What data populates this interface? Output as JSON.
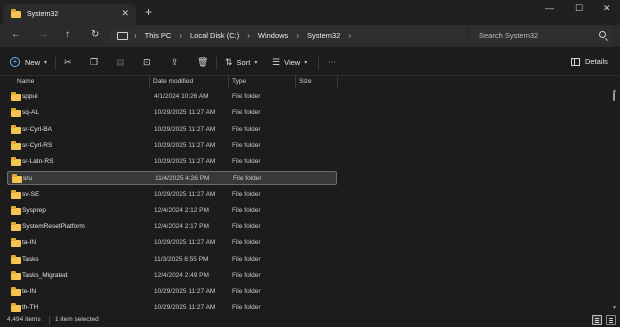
{
  "window": {
    "tab_title": "System32",
    "tab_close": "✕",
    "new_tab": "+",
    "minimize": "—",
    "maximize": "☐",
    "close": "✕"
  },
  "nav": {
    "back": "←",
    "forward": "→",
    "up": "↑",
    "refresh": "↻",
    "breadcrumbs": [
      "This PC",
      "Local Disk (C:)",
      "Windows",
      "System32"
    ],
    "separator": "›",
    "more": "›",
    "search_placeholder": "Search System32"
  },
  "toolbar": {
    "new_label": "New",
    "sort_label": "Sort",
    "view_label": "View",
    "more_label": "···",
    "details_label": "Details"
  },
  "columns": {
    "name": "Name",
    "date": "Date modified",
    "type": "Type",
    "size": "Size"
  },
  "rows": [
    {
      "name": "sppui",
      "date": "4/1/2024 10:26 AM",
      "type": "File folder"
    },
    {
      "name": "sq-AL",
      "date": "10/29/2025 11:27 AM",
      "type": "File folder"
    },
    {
      "name": "sr-Cyrl-BA",
      "date": "10/29/2025 11:27 AM",
      "type": "File folder"
    },
    {
      "name": "sr-Cyrl-RS",
      "date": "10/29/2025 11:27 AM",
      "type": "File folder"
    },
    {
      "name": "sr-Latn-RS",
      "date": "10/29/2025 11:27 AM",
      "type": "File folder"
    },
    {
      "name": "sru",
      "date": "11/4/2025 4:26 PM",
      "type": "File folder",
      "selected": true
    },
    {
      "name": "sv-SE",
      "date": "10/29/2025 11:27 AM",
      "type": "File folder"
    },
    {
      "name": "Sysprep",
      "date": "12/4/2024 2:12 PM",
      "type": "File folder"
    },
    {
      "name": "SystemResetPlatform",
      "date": "12/4/2024 2:17 PM",
      "type": "File folder"
    },
    {
      "name": "ta-IN",
      "date": "10/29/2025 11:27 AM",
      "type": "File folder"
    },
    {
      "name": "Tasks",
      "date": "11/3/2025 8:55 PM",
      "type": "File folder"
    },
    {
      "name": "Tasks_Migrated",
      "date": "12/4/2024 2:49 PM",
      "type": "File folder"
    },
    {
      "name": "te-IN",
      "date": "10/29/2025 11:27 AM",
      "type": "File folder"
    },
    {
      "name": "th-TH",
      "date": "10/29/2025 11:27 AM",
      "type": "File folder"
    }
  ],
  "status": {
    "item_count": "4,494 items",
    "selected": "1 item selected"
  },
  "colors": {
    "folder": "#f5c64f",
    "accent": "#6fb4f0",
    "background": "#1c1c1c"
  }
}
